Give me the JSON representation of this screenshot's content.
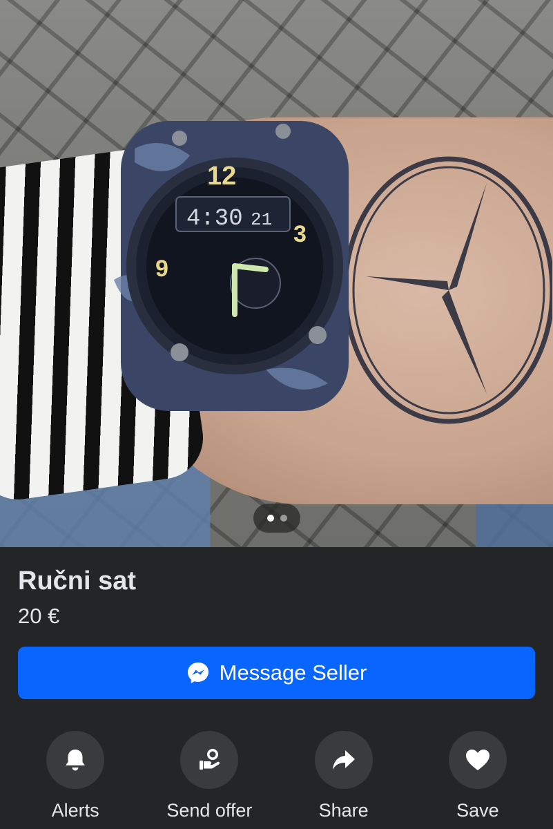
{
  "listing": {
    "title": "Ručni sat",
    "price": "20 €"
  },
  "gallery": {
    "image_count": 2,
    "active_index": 0,
    "image_subject": "watch-photo"
  },
  "primary_action": {
    "label": "Message Seller",
    "icon": "messenger-icon",
    "color": "#0866ff"
  },
  "actions": [
    {
      "label": "Alerts",
      "icon": "bell-icon"
    },
    {
      "label": "Send offer",
      "icon": "offer-hand-icon"
    },
    {
      "label": "Share",
      "icon": "share-arrow-icon"
    },
    {
      "label": "Save",
      "icon": "heart-icon"
    }
  ],
  "colors": {
    "background": "#242526",
    "button_circle": "#3a3b3c",
    "text": "#e4e6eb"
  }
}
